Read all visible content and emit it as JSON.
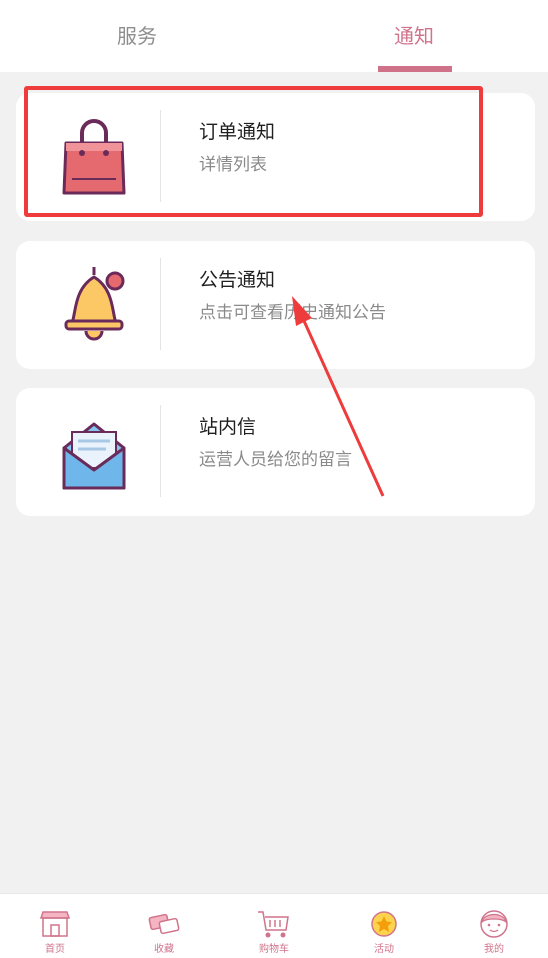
{
  "tabs": [
    {
      "label": "服务",
      "active": false
    },
    {
      "label": "通知",
      "active": true
    }
  ],
  "items": [
    {
      "title": "订单通知",
      "subtitle": "详情列表",
      "icon": "shopping-bag-icon"
    },
    {
      "title": "公告通知",
      "subtitle": "点击可查看历史通知公告",
      "icon": "bell-icon"
    },
    {
      "title": "站内信",
      "subtitle": "运营人员给您的留言",
      "icon": "envelope-icon"
    }
  ],
  "bottom_nav": [
    {
      "label": "首页",
      "icon": "shop-icon"
    },
    {
      "label": "收藏",
      "icon": "tickets-icon"
    },
    {
      "label": "购物车",
      "icon": "cart-icon"
    },
    {
      "label": "活动",
      "icon": "medal-icon"
    },
    {
      "label": "我的",
      "icon": "avatar-icon"
    }
  ],
  "colors": {
    "accent": "#cf7189",
    "highlight": "#ee3b3b",
    "background": "#f1f1f1"
  }
}
